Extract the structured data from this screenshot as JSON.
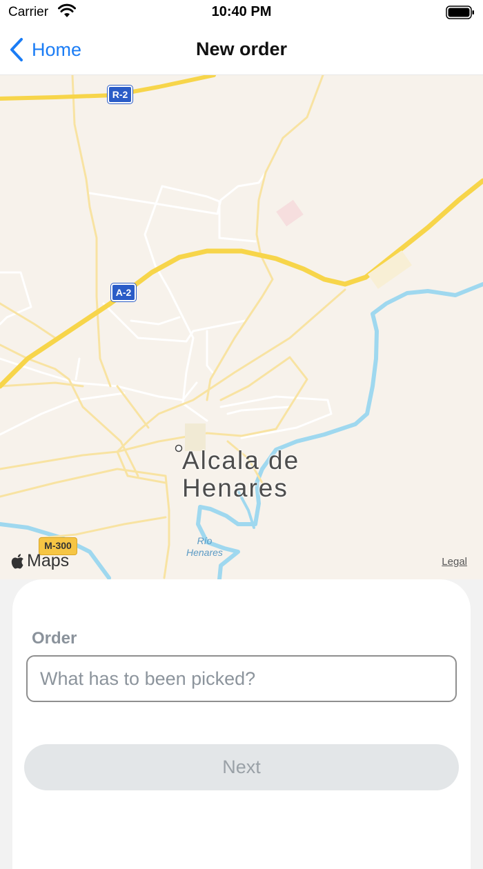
{
  "status_bar": {
    "carrier": "Carrier",
    "time": "10:40 PM"
  },
  "nav": {
    "back_label": "Home",
    "title": "New order"
  },
  "map": {
    "city": "Alcala de\nHenares",
    "river": "Río\nHenares",
    "road_labels": [
      "R-2",
      "A-2",
      "M-300"
    ],
    "attribution": "Maps",
    "legal": "Legal"
  },
  "form": {
    "label": "Order",
    "input_value": "",
    "input_placeholder": "What has to been picked?",
    "next_label": "Next"
  },
  "colors": {
    "accent": "#1a7cf5",
    "disabled_button": "#e3e6e8",
    "highway": "#f7d54a",
    "water": "#9fd8ef"
  }
}
